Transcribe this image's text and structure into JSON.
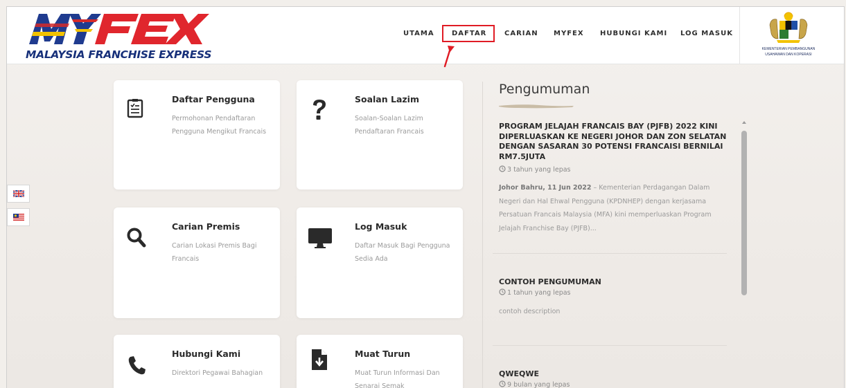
{
  "header": {
    "logo_text": "MYFEX",
    "logo_tagline": "MALAYSIA FRANCHISE EXPRESS",
    "nav": [
      {
        "label": "UTAMA"
      },
      {
        "label": "DAFTAR",
        "highlighted": true
      },
      {
        "label": "CARIAN"
      },
      {
        "label": "MYFEX"
      },
      {
        "label": "HUBUNGI KAMI"
      },
      {
        "label": "LOG MASUK"
      }
    ],
    "ministry_line1": "KEMENTERIAN PEMBANGUNAN",
    "ministry_line2": "USAHAWAN DAN KOPERASI",
    "highlight_color": "#e01b24"
  },
  "language_flags": [
    {
      "icon": "uk-flag-icon"
    },
    {
      "icon": "malaysia-flag-icon"
    }
  ],
  "cards": [
    {
      "title": "Daftar Pengguna",
      "desc": "Permohonan Pendaftaran Pengguna Mengikut Francais",
      "icon": "register-form-icon"
    },
    {
      "title": "Soalan Lazim",
      "desc": "Soalan-Soalan Lazim Pendaftaran Francais",
      "icon": "question-mark-icon"
    },
    {
      "title": "Carian Premis",
      "desc": "Carian Lokasi Premis Bagi Francais",
      "icon": "search-icon"
    },
    {
      "title": "Log Masuk",
      "desc": "Daftar Masuk Bagi Pengguna Sedia Ada",
      "icon": "monitor-icon"
    },
    {
      "title": "Hubungi Kami",
      "desc": "Direktori Pegawai Bahagian",
      "icon": "phone-icon"
    },
    {
      "title": "Muat Turun",
      "desc": "Muat Turun Informasi Dan Senarai Semak",
      "icon": "download-file-icon"
    }
  ],
  "announcements": {
    "heading": "Pengumuman",
    "items": [
      {
        "title": "PROGRAM JELAJAH FRANCAIS BAY (PJFB) 2022 KINI DIPERLUASKAN KE NEGERI JOHOR DAN ZON SELATAN DENGAN SASARAN 30 POTENSI FRANCAISI BERNILAI RM7.5JUTA",
        "time": "3 tahun yang lepas",
        "desc_lead": "Johor Bahru, 11 Jun 2022",
        "desc": " – Kementerian Perdagangan Dalam Negeri dan Hal Ehwal Pengguna (KPDNHEP) dengan kerjasama Persatuan Francais Malaysia (MFA) kini memperluaskan  Program Jelajah Franchise Bay (PJFB)..."
      },
      {
        "title": "CONTOH PENGUMUMAN",
        "time": "1 tahun yang lepas",
        "desc": "contoh description"
      },
      {
        "title": "QWEQWE",
        "time": "9 bulan yang lepas"
      }
    ]
  }
}
